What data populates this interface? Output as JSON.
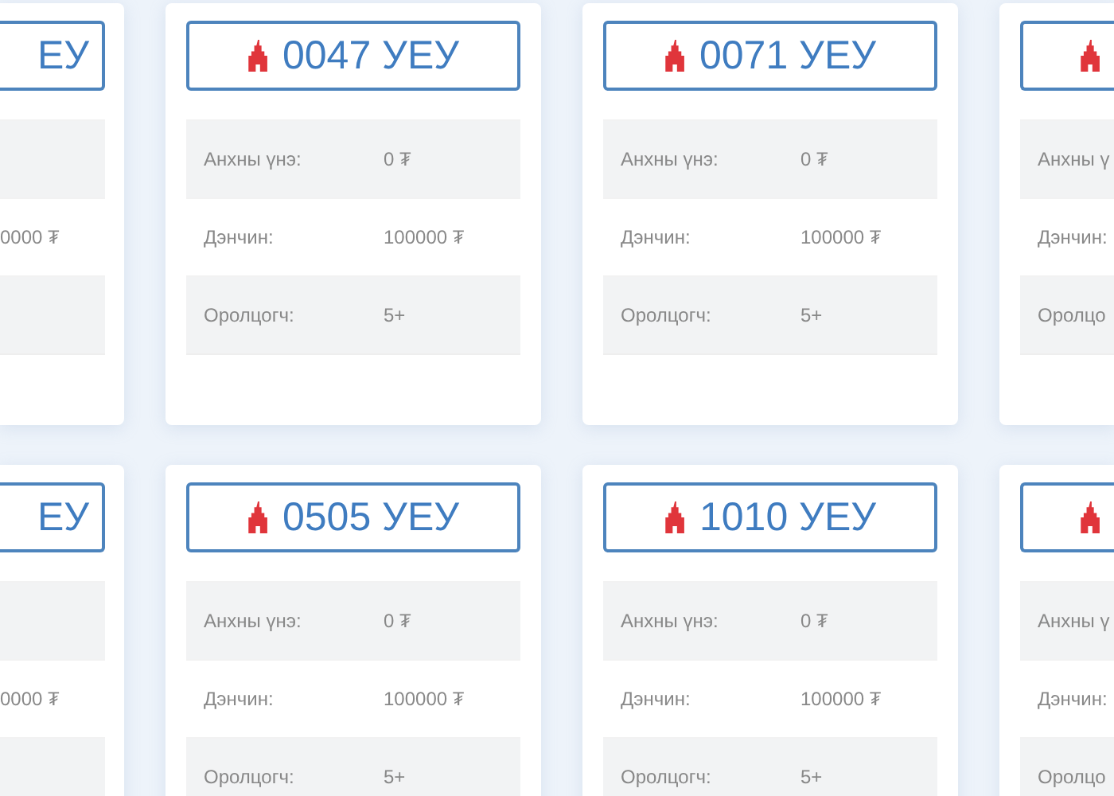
{
  "card_rows": [
    {
      "cards": [
        {
          "kind": "cut_left",
          "plate": "ЕУ",
          "fields": [
            {
              "kind": "deposit",
              "value": "0000 ₮"
            }
          ]
        },
        {
          "kind": "full",
          "plate": "0047 УЕУ",
          "fields": [
            {
              "kind": "price",
              "label": "Анхны үнэ:",
              "value": "0 ₮"
            },
            {
              "kind": "deposit",
              "label": "Дэнчин:",
              "value": "100000 ₮"
            },
            {
              "kind": "bidders",
              "label": "Оролцогч:",
              "value": "5+"
            }
          ]
        },
        {
          "kind": "full",
          "plate": "0071 УЕУ",
          "fields": [
            {
              "kind": "price",
              "label": "Анхны үнэ:",
              "value": "0 ₮"
            },
            {
              "kind": "deposit",
              "label": "Дэнчин:",
              "value": "100000 ₮"
            },
            {
              "kind": "bidders",
              "label": "Оролцогч:",
              "value": "5+"
            }
          ]
        },
        {
          "kind": "cut_right",
          "fields": [
            {
              "kind": "price",
              "label": "Анхны ү"
            },
            {
              "kind": "deposit",
              "label": "Дэнчин:"
            },
            {
              "kind": "bidders",
              "label": "Оролцо"
            }
          ]
        }
      ]
    },
    {
      "cards": [
        {
          "kind": "cut_left",
          "plate": "ЕУ",
          "fields": [
            {
              "kind": "deposit",
              "value": "0000 ₮"
            }
          ]
        },
        {
          "kind": "full",
          "plate": "0505 УЕУ",
          "fields": [
            {
              "kind": "price",
              "label": "Анхны үнэ:",
              "value": "0 ₮"
            },
            {
              "kind": "deposit",
              "label": "Дэнчин:",
              "value": "100000 ₮"
            },
            {
              "kind": "bidders",
              "label": "Оролцогч:",
              "value": "5+"
            }
          ]
        },
        {
          "kind": "full",
          "plate": "1010 УЕУ",
          "fields": [
            {
              "kind": "price",
              "label": "Анхны үнэ:",
              "value": "0 ₮"
            },
            {
              "kind": "deposit",
              "label": "Дэнчин:",
              "value": "100000 ₮"
            },
            {
              "kind": "bidders",
              "label": "Оролцогч:",
              "value": "5+"
            }
          ]
        },
        {
          "kind": "cut_right",
          "fields": [
            {
              "kind": "price",
              "label": "Анхны ү"
            },
            {
              "kind": "deposit",
              "label": "Дэнчин:"
            },
            {
              "kind": "bidders",
              "label": "Оролцо"
            }
          ]
        }
      ]
    }
  ]
}
